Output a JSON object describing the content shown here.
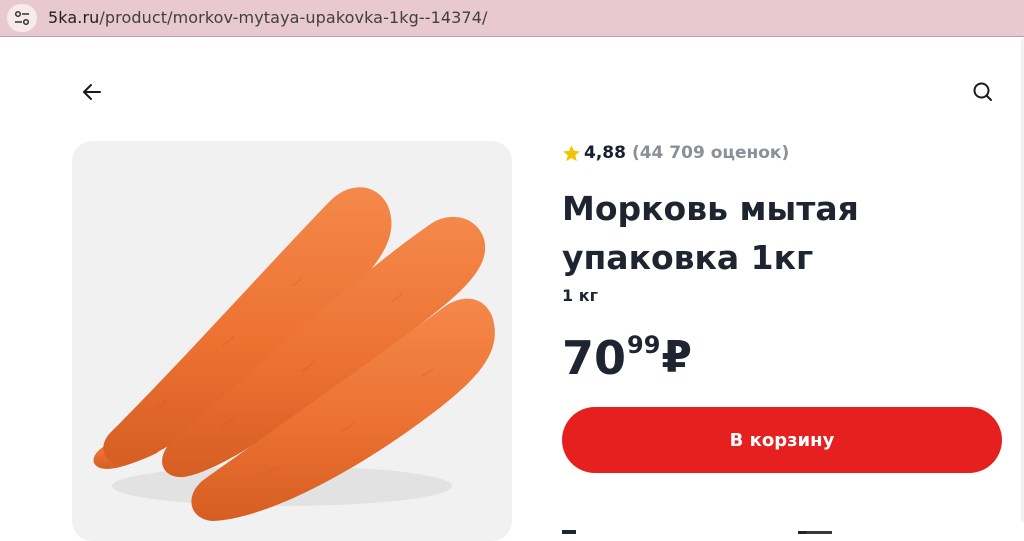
{
  "browser": {
    "url_host": "5ka.ru",
    "url_path": "/product/morkov-mytaya-upakovka-1kg--14374/",
    "site_settings_icon": "tune-icon"
  },
  "header": {
    "back_icon": "arrow-left-icon",
    "search_icon": "search-icon"
  },
  "product": {
    "image_alt": "carrots",
    "rating_value": "4,88",
    "rating_count": "(44 709 оценок)",
    "title": "Морковь мытая упаковка 1кг",
    "weight": "1 кг",
    "price_rub": "70",
    "price_kop": "99",
    "currency": "₽",
    "add_to_cart_label": "В корзину"
  },
  "colors": {
    "accent": "#e5201e",
    "star": "#f5c400",
    "text_dark": "#1f2431",
    "text_muted": "#8b8f96",
    "carrot": "#ee7434"
  }
}
